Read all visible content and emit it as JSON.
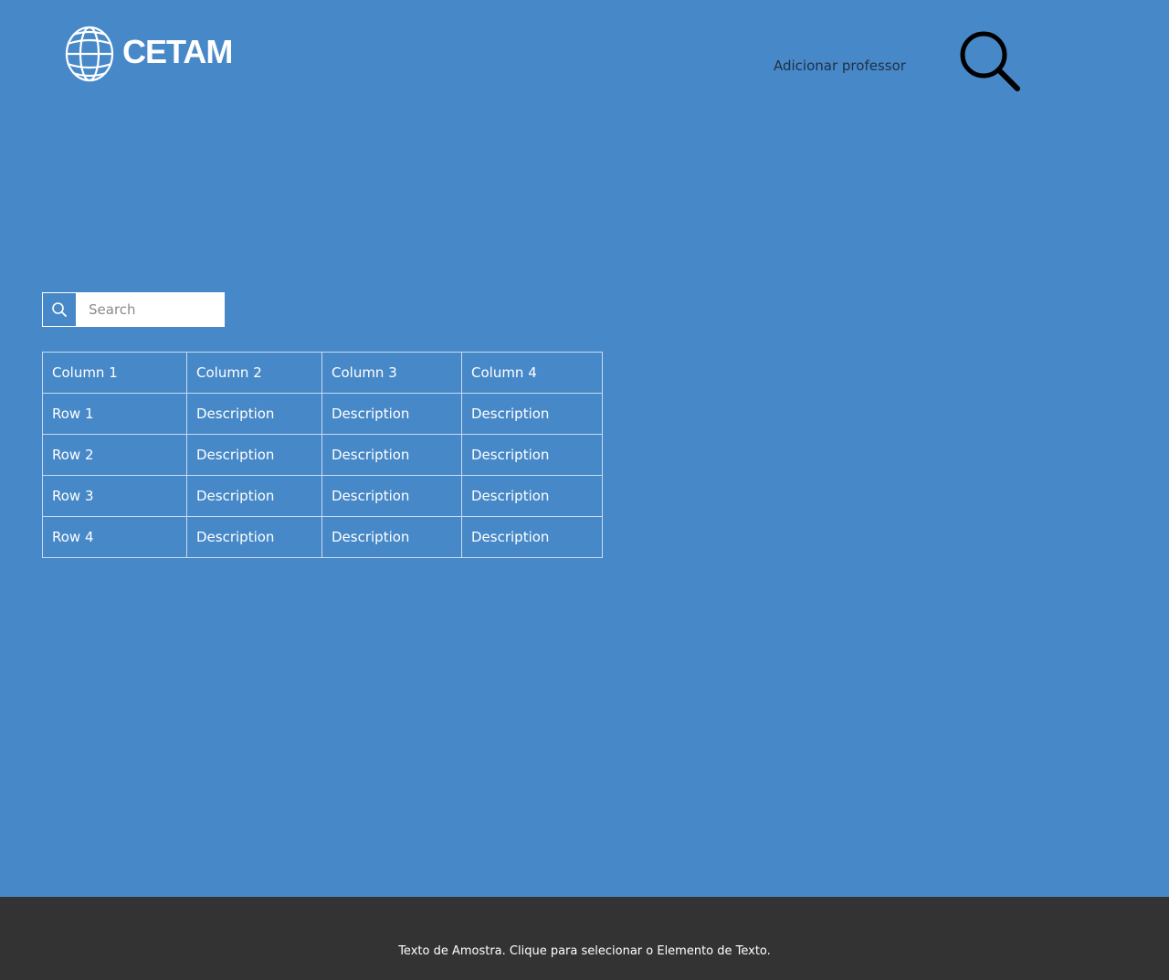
{
  "header": {
    "logo_text": "CETAM",
    "nav_link": "Adicionar professor"
  },
  "search": {
    "placeholder": "Search",
    "value": ""
  },
  "table": {
    "columns": [
      "Column 1",
      "Column 2",
      "Column 3",
      "Column 4"
    ],
    "rows": [
      [
        "Row 1",
        "Description",
        "Description",
        "Description"
      ],
      [
        "Row 2",
        "Description",
        "Description",
        "Description"
      ],
      [
        "Row 3",
        "Description",
        "Description",
        "Description"
      ],
      [
        "Row 4",
        "Description",
        "Description",
        "Description"
      ]
    ]
  },
  "footer": {
    "text": "Texto de Amostra. Clique para selecionar o Elemento de Texto."
  },
  "colors": {
    "page_background": "#4789c8",
    "footer_background": "#333333",
    "nav_text": "#1f2f45"
  },
  "icons": {
    "logo": "globe-icon",
    "header_search": "search-icon",
    "search_button": "search-icon"
  }
}
